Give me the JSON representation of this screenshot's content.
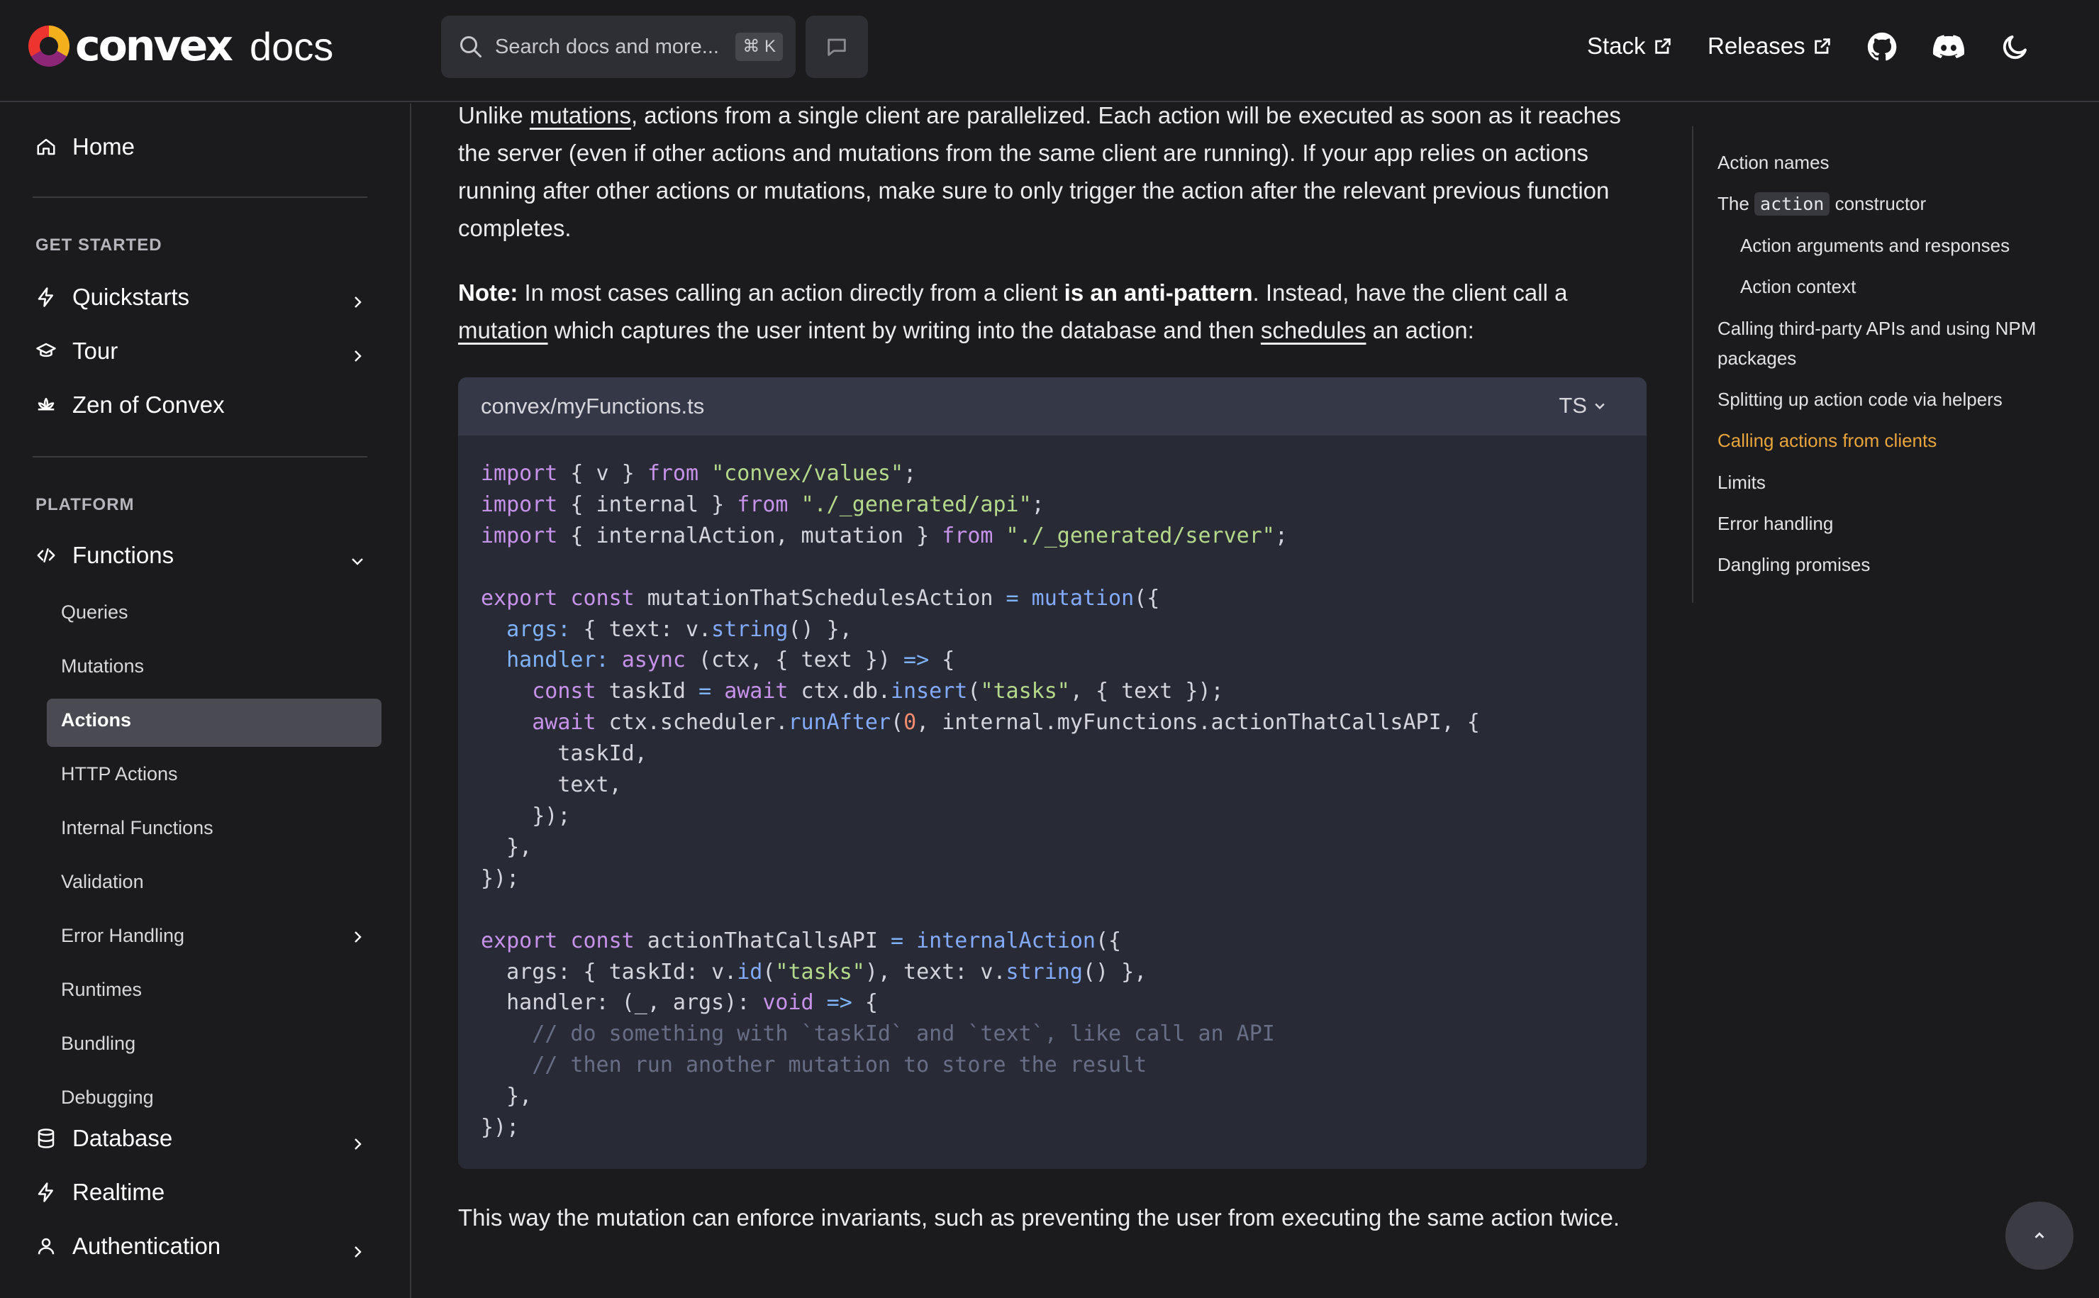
{
  "navbar": {
    "brand_word": "convex",
    "brand_suffix": "docs",
    "search_placeholder": "Search docs and more...",
    "search_shortcut": "⌘ K",
    "links": [
      {
        "label": "Stack"
      },
      {
        "label": "Releases"
      }
    ],
    "icons": [
      "github-icon",
      "discord-icon",
      "moon-icon"
    ]
  },
  "sidebar": {
    "home": "Home",
    "sections": {
      "get_started": "GET STARTED",
      "platform": "PLATFORM"
    },
    "get_started_items": [
      {
        "label": "Quickstarts",
        "icon": "bolt-icon"
      },
      {
        "label": "Tour",
        "icon": "graduation-cap-icon"
      },
      {
        "label": "Zen of Convex",
        "icon": "lotus-icon"
      }
    ],
    "functions": {
      "label": "Functions",
      "children": [
        "Queries",
        "Mutations",
        "Actions",
        "HTTP Actions",
        "Internal Functions",
        "Validation",
        "Error Handling",
        "Runtimes",
        "Bundling",
        "Debugging"
      ],
      "active": "Actions"
    },
    "more_items": [
      {
        "label": "Database",
        "icon": "database-icon"
      },
      {
        "label": "Realtime",
        "icon": "bolt-icon"
      },
      {
        "label": "Authentication",
        "icon": "user-icon"
      }
    ]
  },
  "content": {
    "para1": {
      "before": "Unlike ",
      "link": "mutations",
      "after": ", actions from a single client are parallelized. Each action will be executed as soon as it reaches the server (even if other actions and mutations from the same client are running). If your app relies on actions running after other actions or mutations, make sure to only trigger the action after the relevant previous function completes."
    },
    "para2": {
      "note": "Note:",
      "t1": " In most cases calling an action directly from a client ",
      "bold": "is an anti-pattern",
      "t2": ". Instead, have the client call a ",
      "link1": "mutation",
      "t3": " which captures the user intent by writing into the database and then ",
      "link2": "schedules",
      "t4": " an action:"
    },
    "code": {
      "filename": "convex/myFunctions.ts",
      "language": "TS"
    },
    "para3": "This way the mutation can enforce invariants, such as preventing the user from executing the same action twice."
  },
  "toc": {
    "items": [
      {
        "label": "Action names",
        "level": 1
      },
      {
        "label_before": "The ",
        "code": "action",
        "label_after": " constructor",
        "level": 1
      },
      {
        "label": "Action arguments and responses",
        "level": 2
      },
      {
        "label": "Action context",
        "level": 2
      },
      {
        "label": "Calling third-party APIs and using NPM packages",
        "level": 1
      },
      {
        "label": "Splitting up action code via helpers",
        "level": 1
      },
      {
        "label": "Calling actions from clients",
        "level": 1,
        "active": true
      },
      {
        "label": "Limits",
        "level": 1
      },
      {
        "label": "Error handling",
        "level": 1
      },
      {
        "label": "Dangling promises",
        "level": 1
      }
    ]
  },
  "colors": {
    "background": "#1b1b1d",
    "accent_active_toc": "#e9a43b",
    "code_background": "#282a36"
  }
}
